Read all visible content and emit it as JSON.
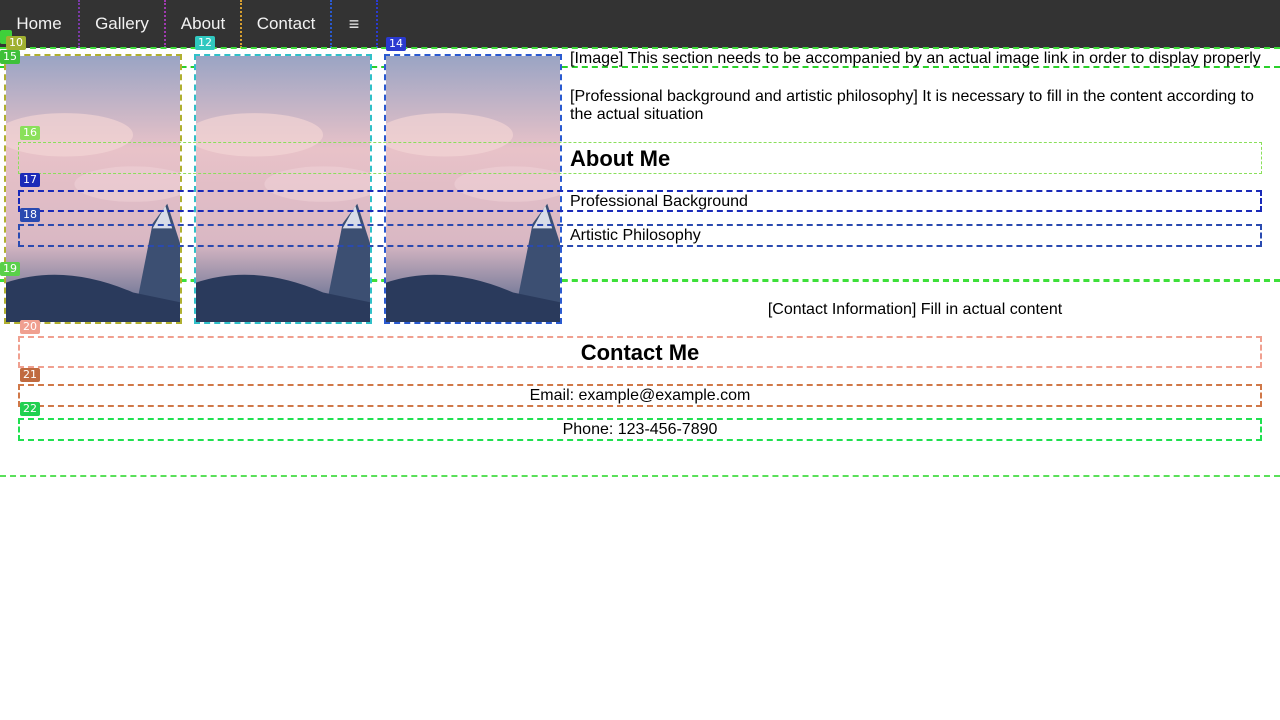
{
  "nav": {
    "items": [
      "Home",
      "Gallery",
      "About",
      "Contact"
    ],
    "menu_icon": "≡"
  },
  "badges": {
    "b10": "10",
    "b12": "12",
    "b14": "14",
    "b15": "15",
    "b16": "16",
    "b17": "17",
    "b18": "18",
    "b19": "19",
    "b20": "20",
    "b21": "21",
    "b22": "22"
  },
  "about": {
    "image_note": "[Image] This section needs to be accompanied by an actual image link in order to display properly",
    "background_note": "[Professional background and artistic philosophy] It is necessary to fill in the content according to the actual situation",
    "heading": "About Me",
    "items": [
      "Professional Background",
      "Artistic Philosophy"
    ]
  },
  "contact": {
    "note": "[Contact Information] Fill in actual content",
    "heading": "Contact Me",
    "email": "Email: example@example.com",
    "phone": "Phone: 123-456-7890"
  },
  "colors": {
    "nav_bg": "#333333",
    "nav_text": "#f2f2f2"
  }
}
